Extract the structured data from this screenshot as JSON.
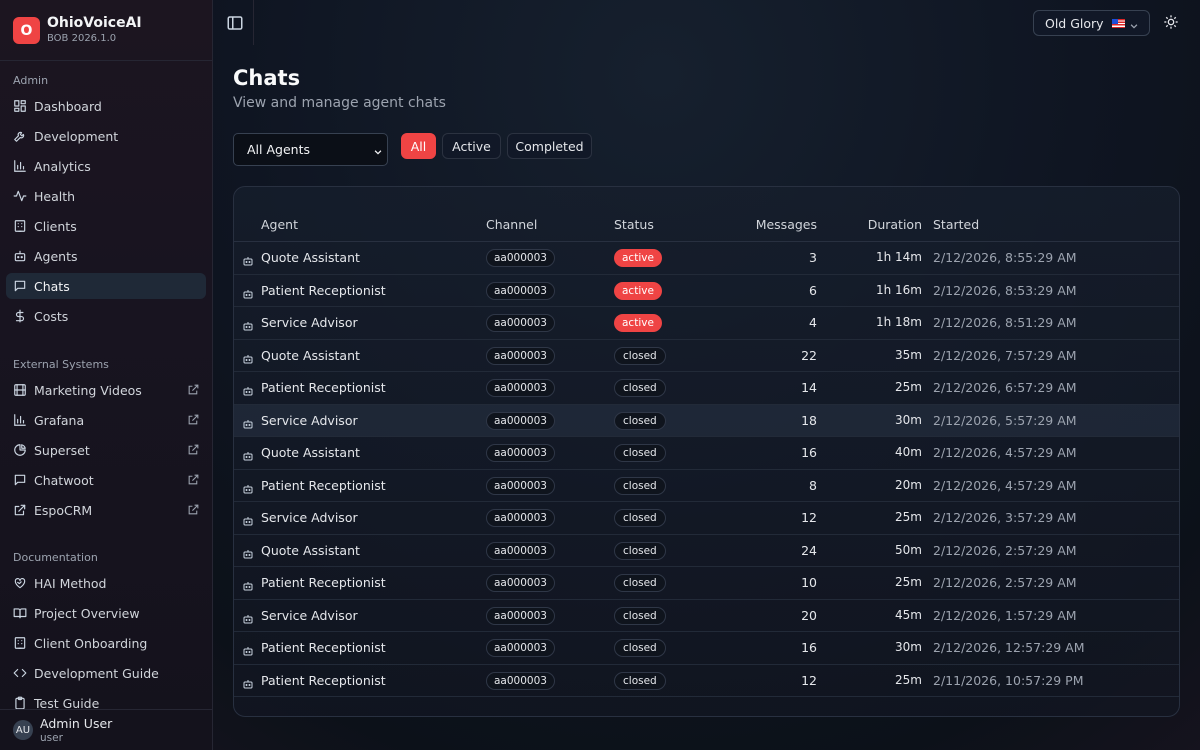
{
  "brand": {
    "logo_letter": "O",
    "name": "OhioVoiceAI",
    "version": "BOB 2026.1.0",
    "accent": "#ef4444"
  },
  "sidebar": {
    "admin_label": "Admin",
    "admin_items": [
      {
        "label": "Dashboard",
        "icon": "dashboard-icon"
      },
      {
        "label": "Development",
        "icon": "wrench-icon"
      },
      {
        "label": "Analytics",
        "icon": "bar-chart-icon"
      },
      {
        "label": "Health",
        "icon": "activity-icon"
      },
      {
        "label": "Clients",
        "icon": "building-icon"
      },
      {
        "label": "Agents",
        "icon": "bot-icon"
      },
      {
        "label": "Chats",
        "icon": "message-icon",
        "active": true
      },
      {
        "label": "Costs",
        "icon": "dollar-icon"
      }
    ],
    "external_label": "External Systems",
    "external_items": [
      {
        "label": "Marketing Videos",
        "icon": "film-icon"
      },
      {
        "label": "Grafana",
        "icon": "bar-chart-icon"
      },
      {
        "label": "Superset",
        "icon": "pie-chart-icon"
      },
      {
        "label": "Chatwoot",
        "icon": "message-icon"
      },
      {
        "label": "EspoCRM",
        "icon": "external-link-icon"
      }
    ],
    "docs_label": "Documentation",
    "docs_items": [
      {
        "label": "HAI Method",
        "icon": "heart-handshake-icon"
      },
      {
        "label": "Project Overview",
        "icon": "book-icon"
      },
      {
        "label": "Client Onboarding",
        "icon": "building-icon"
      },
      {
        "label": "Development Guide",
        "icon": "code-icon"
      },
      {
        "label": "Test Guide",
        "icon": "clipboard-icon"
      }
    ],
    "user": {
      "initials": "AU",
      "name": "Admin User",
      "role": "user"
    }
  },
  "topbar": {
    "theme_label": "Old Glory",
    "theme_flag": "us-flag-icon"
  },
  "page": {
    "title": "Chats",
    "subtitle": "View and manage agent chats"
  },
  "filters": {
    "agent_select": "All Agents",
    "tabs": [
      {
        "label": "All",
        "active": true
      },
      {
        "label": "Active"
      },
      {
        "label": "Completed"
      }
    ]
  },
  "table": {
    "columns": [
      "Agent",
      "Channel",
      "Status",
      "Messages",
      "Duration",
      "Started"
    ],
    "rows": [
      [
        "Quote Assistant",
        "aa000003",
        "active",
        "3",
        "1h 14m",
        "2/12/2026, 8:55:29 AM"
      ],
      [
        "Patient Receptionist",
        "aa000003",
        "active",
        "6",
        "1h 16m",
        "2/12/2026, 8:53:29 AM"
      ],
      [
        "Service Advisor",
        "aa000003",
        "active",
        "4",
        "1h 18m",
        "2/12/2026, 8:51:29 AM"
      ],
      [
        "Quote Assistant",
        "aa000003",
        "closed",
        "22",
        "35m",
        "2/12/2026, 7:57:29 AM"
      ],
      [
        "Patient Receptionist",
        "aa000003",
        "closed",
        "14",
        "25m",
        "2/12/2026, 6:57:29 AM"
      ],
      [
        "Service Advisor",
        "aa000003",
        "closed",
        "18",
        "30m",
        "2/12/2026, 5:57:29 AM"
      ],
      [
        "Quote Assistant",
        "aa000003",
        "closed",
        "16",
        "40m",
        "2/12/2026, 4:57:29 AM"
      ],
      [
        "Patient Receptionist",
        "aa000003",
        "closed",
        "8",
        "20m",
        "2/12/2026, 4:57:29 AM"
      ],
      [
        "Service Advisor",
        "aa000003",
        "closed",
        "12",
        "25m",
        "2/12/2026, 3:57:29 AM"
      ],
      [
        "Quote Assistant",
        "aa000003",
        "closed",
        "24",
        "50m",
        "2/12/2026, 2:57:29 AM"
      ],
      [
        "Patient Receptionist",
        "aa000003",
        "closed",
        "10",
        "25m",
        "2/12/2026, 2:57:29 AM"
      ],
      [
        "Service Advisor",
        "aa000003",
        "closed",
        "20",
        "45m",
        "2/12/2026, 1:57:29 AM"
      ],
      [
        "Patient Receptionist",
        "aa000003",
        "closed",
        "16",
        "30m",
        "2/12/2026, 12:57:29 AM"
      ],
      [
        "Patient Receptionist",
        "aa000003",
        "closed",
        "12",
        "25m",
        "2/11/2026, 10:57:29 PM"
      ]
    ]
  }
}
